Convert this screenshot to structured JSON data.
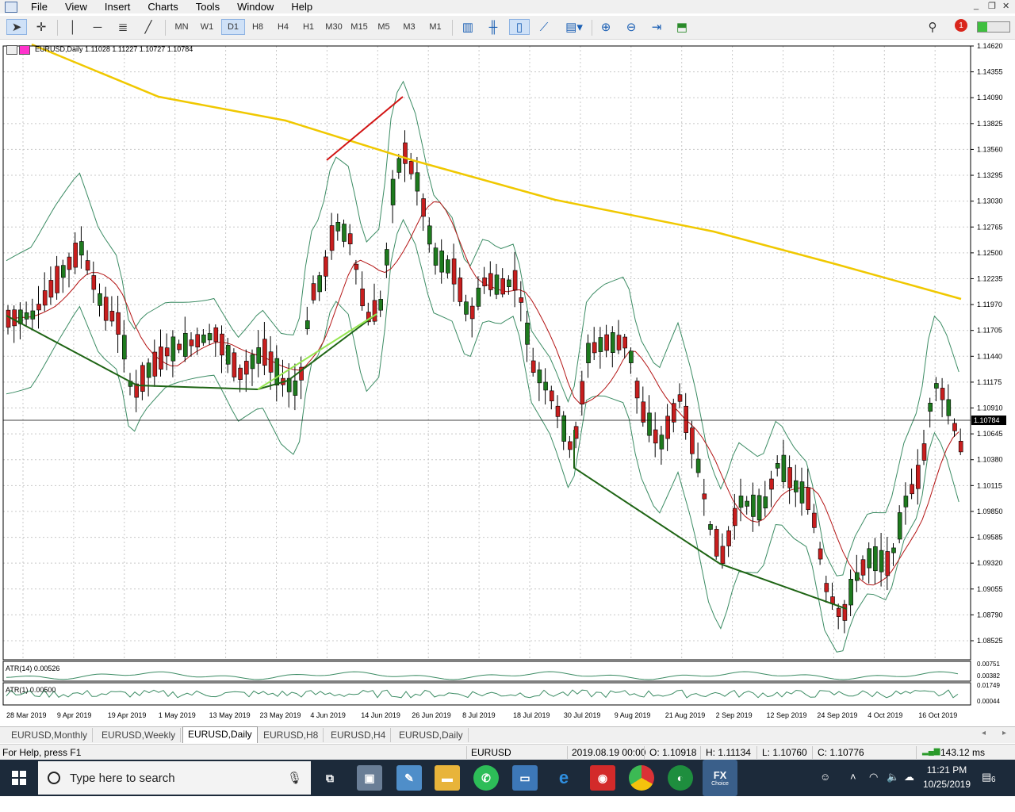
{
  "menu": {
    "items": [
      "File",
      "View",
      "Insert",
      "Charts",
      "Tools",
      "Window",
      "Help"
    ]
  },
  "toolbar": {
    "timeframes": [
      "MN",
      "W1",
      "D1",
      "H8",
      "H4",
      "H1",
      "M30",
      "M15",
      "M5",
      "M3",
      "M1"
    ],
    "active_timeframe": "D1",
    "notification_count": "1"
  },
  "chart": {
    "header": "EURUSD,Daily  1.11028 1.11227 1.10727 1.10784",
    "price_ticks": [
      "1.14620",
      "1.14355",
      "1.14090",
      "1.13825",
      "1.13560",
      "1.13295",
      "1.13030",
      "1.12765",
      "1.12500",
      "1.12235",
      "1.11970",
      "1.11705",
      "1.11440",
      "1.11175",
      "1.10910",
      "1.10645",
      "1.10380",
      "1.10115",
      "1.09850",
      "1.09585",
      "1.09320",
      "1.09055",
      "1.08790",
      "1.08525"
    ],
    "current_price": "1.10784",
    "date_ticks": [
      "28 Mar 2019",
      "9 Apr 2019",
      "19 Apr 2019",
      "1 May 2019",
      "13 May 2019",
      "23 May 2019",
      "4 Jun 2019",
      "14 Jun 2019",
      "26 Jun 2019",
      "8 Jul 2019",
      "18 Jul 2019",
      "30 Jul 2019",
      "9 Aug 2019",
      "21 Aug 2019",
      "2 Sep 2019",
      "12 Sep 2019",
      "24 Sep 2019",
      "4 Oct 2019",
      "16 Oct 2019"
    ],
    "atr14": {
      "label": "ATR(14) 0.00526",
      "ticks": [
        "0.00751",
        "0.00382"
      ]
    },
    "atr1": {
      "label": "ATR(1) 0.00500",
      "ticks": [
        "0.01749",
        "0.00044"
      ]
    },
    "colors": {
      "bull": "#1e7a1e",
      "bear": "#c81e1e",
      "ma_slow": "#f0c800",
      "ma_fast": "#b41414",
      "bands": "#3c8c64",
      "trend_dark": "#1e6414",
      "trend_light": "#96e650",
      "trend_red": "#d21414"
    }
  },
  "tabs": [
    "EURUSD,Monthly",
    "EURUSD,Weekly",
    "EURUSD,Daily",
    "EURUSD,H8",
    "EURUSD,H4",
    "EURUSD,Daily"
  ],
  "status": {
    "help": "For Help, press F1",
    "symbol": "EURUSD",
    "datetime": "2019.08.19 00:00",
    "open": "O: 1.10918",
    "high": "H: 1.11134",
    "low": "L: 1.10760",
    "close": "C: 1.10776",
    "ping": "143.12 ms"
  },
  "taskbar": {
    "search_placeholder": "Type here to search",
    "time": "11:21 PM",
    "date": "10/25/2019",
    "notifications": "6",
    "fx_label": "FX",
    "fx_sub": "Choice"
  }
}
